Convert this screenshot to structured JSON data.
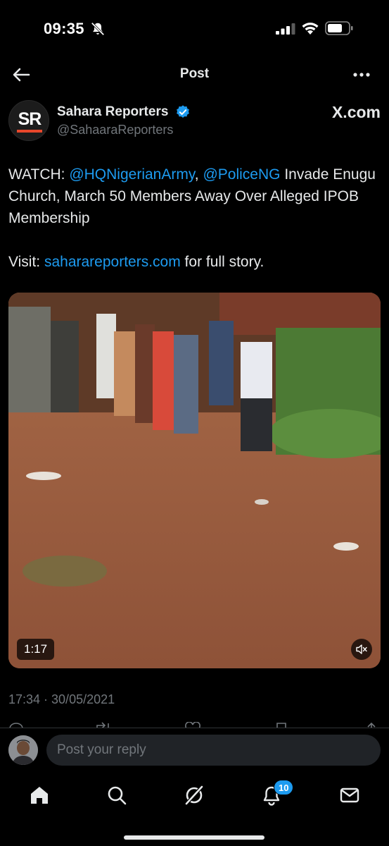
{
  "status_bar": {
    "time": "09:35",
    "icons": [
      "bell-off-icon",
      "cellular-signal-icon",
      "wifi-icon",
      "battery-icon"
    ]
  },
  "nav": {
    "title": "Post",
    "back_icon": "arrow-left-icon",
    "more_icon": "more-horizontal-icon"
  },
  "author": {
    "avatar_text": "SR",
    "name": "Sahara Reporters",
    "handle": "@SahaaraReporters",
    "verified": true,
    "source": "X.com"
  },
  "tweet": {
    "line1_prefix": "WATCH: ",
    "mention1": "@HQNigerianArmy",
    "separator": ", ",
    "mention2": "@PoliceNG",
    "line1_rest": " Invade Enugu Church, March 50 Members Away Over Alleged IPOB Membership",
    "visit_prefix": "Visit: ",
    "visit_link": "saharareporters.com",
    "visit_suffix": " for full story."
  },
  "video": {
    "duration": "1:17",
    "muted": true
  },
  "timestamp": "17:34 · 30/05/2021",
  "reply": {
    "placeholder": "Post your reply"
  },
  "tabbar": {
    "items": [
      "home-icon",
      "search-icon",
      "grok-icon",
      "notifications-icon",
      "messages-icon"
    ],
    "notifications_badge": "10"
  },
  "colors": {
    "background": "#000000",
    "text": "#e7e9ea",
    "muted": "#71767b",
    "accent": "#1d9bf0",
    "sr_brand": "#e8472b"
  }
}
